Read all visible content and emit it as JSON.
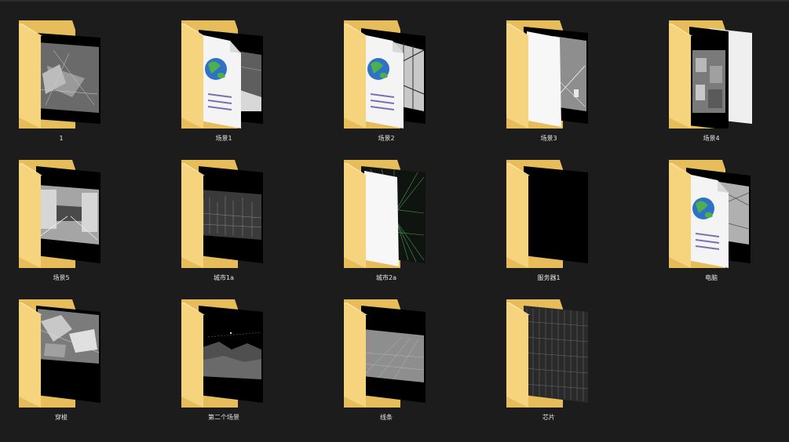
{
  "view": "explorer-large-icons",
  "items": [
    {
      "label": "1",
      "preview": "jet"
    },
    {
      "label": "场景1",
      "preview": "doc-road"
    },
    {
      "label": "场景2",
      "preview": "doc-corridor"
    },
    {
      "label": "场景3",
      "preview": "blank-corridor"
    },
    {
      "label": "场景4",
      "preview": "city-blocks"
    },
    {
      "label": "场景5",
      "preview": "hallway"
    },
    {
      "label": "城市1a",
      "preview": "city-wire"
    },
    {
      "label": "城市2a",
      "preview": "green-lines"
    },
    {
      "label": "服务器1",
      "preview": "black"
    },
    {
      "label": "电脑",
      "preview": "doc-tunnel"
    },
    {
      "label": "穿梭",
      "preview": "aerial"
    },
    {
      "label": "第二个场景",
      "preview": "terrain"
    },
    {
      "label": "线条",
      "preview": "grid-floor"
    },
    {
      "label": "芯片",
      "preview": "chip"
    }
  ],
  "colors": {
    "background": "#1c1c1c",
    "folder_back": "#e7bc5b",
    "folder_front": "#f6d47e",
    "label_text": "#e6e6e6"
  }
}
